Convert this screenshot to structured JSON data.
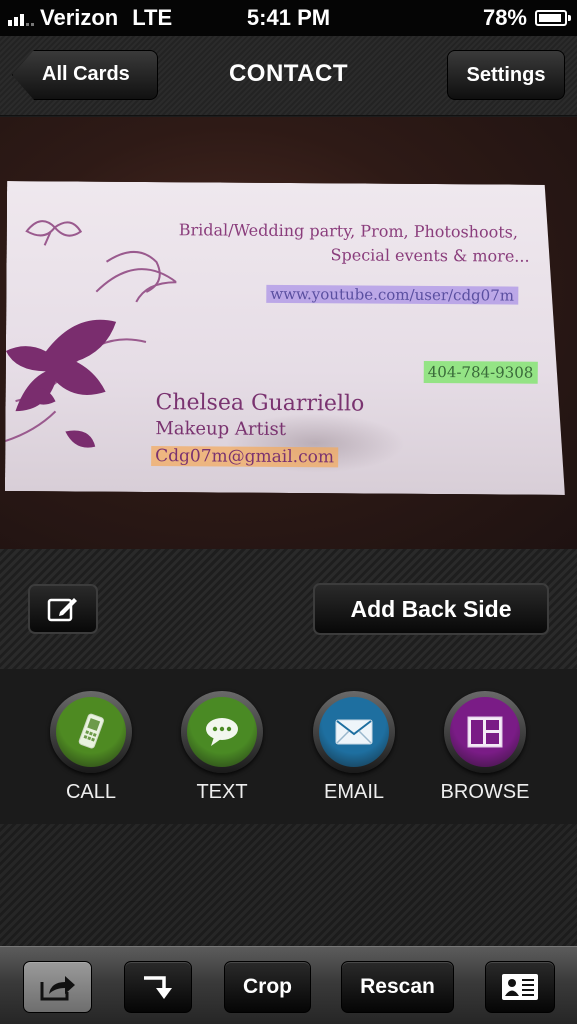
{
  "status_bar": {
    "carrier": "Verizon",
    "network": "LTE",
    "time": "5:41 PM",
    "battery_percent": "78%",
    "battery_level": 0.78
  },
  "nav": {
    "back_label": "All Cards",
    "title": "CONTACT",
    "settings_label": "Settings"
  },
  "card": {
    "tagline_line1": "Bridal/Wedding party, Prom, Photoshoots,",
    "tagline_line2": "Special events & more...",
    "url": "www.youtube.com/user/cdg07m",
    "phone": "404-784-9308",
    "name": "Chelsea Guarriello",
    "role": "Makeup Artist",
    "email": "Cdg07m@gmail.com"
  },
  "mid_bar": {
    "add_back_side_label": "Add Back Side",
    "edit_icon": "edit-icon"
  },
  "actions": [
    {
      "label": "CALL",
      "icon": "phone-icon",
      "color": "#4e8a22"
    },
    {
      "label": "TEXT",
      "icon": "chat-bubble-icon",
      "color": "#4a8a24"
    },
    {
      "label": "EMAIL",
      "icon": "envelope-icon",
      "color": "#1e6fa0"
    },
    {
      "label": "BROWSE",
      "icon": "browse-icon",
      "color": "#7a1c86"
    }
  ],
  "bottom_bar": {
    "share_icon": "share-icon",
    "rotate_icon": "rotate-icon",
    "crop_label": "Crop",
    "rescan_label": "Rescan",
    "contact_card_icon": "contact-card-icon"
  }
}
